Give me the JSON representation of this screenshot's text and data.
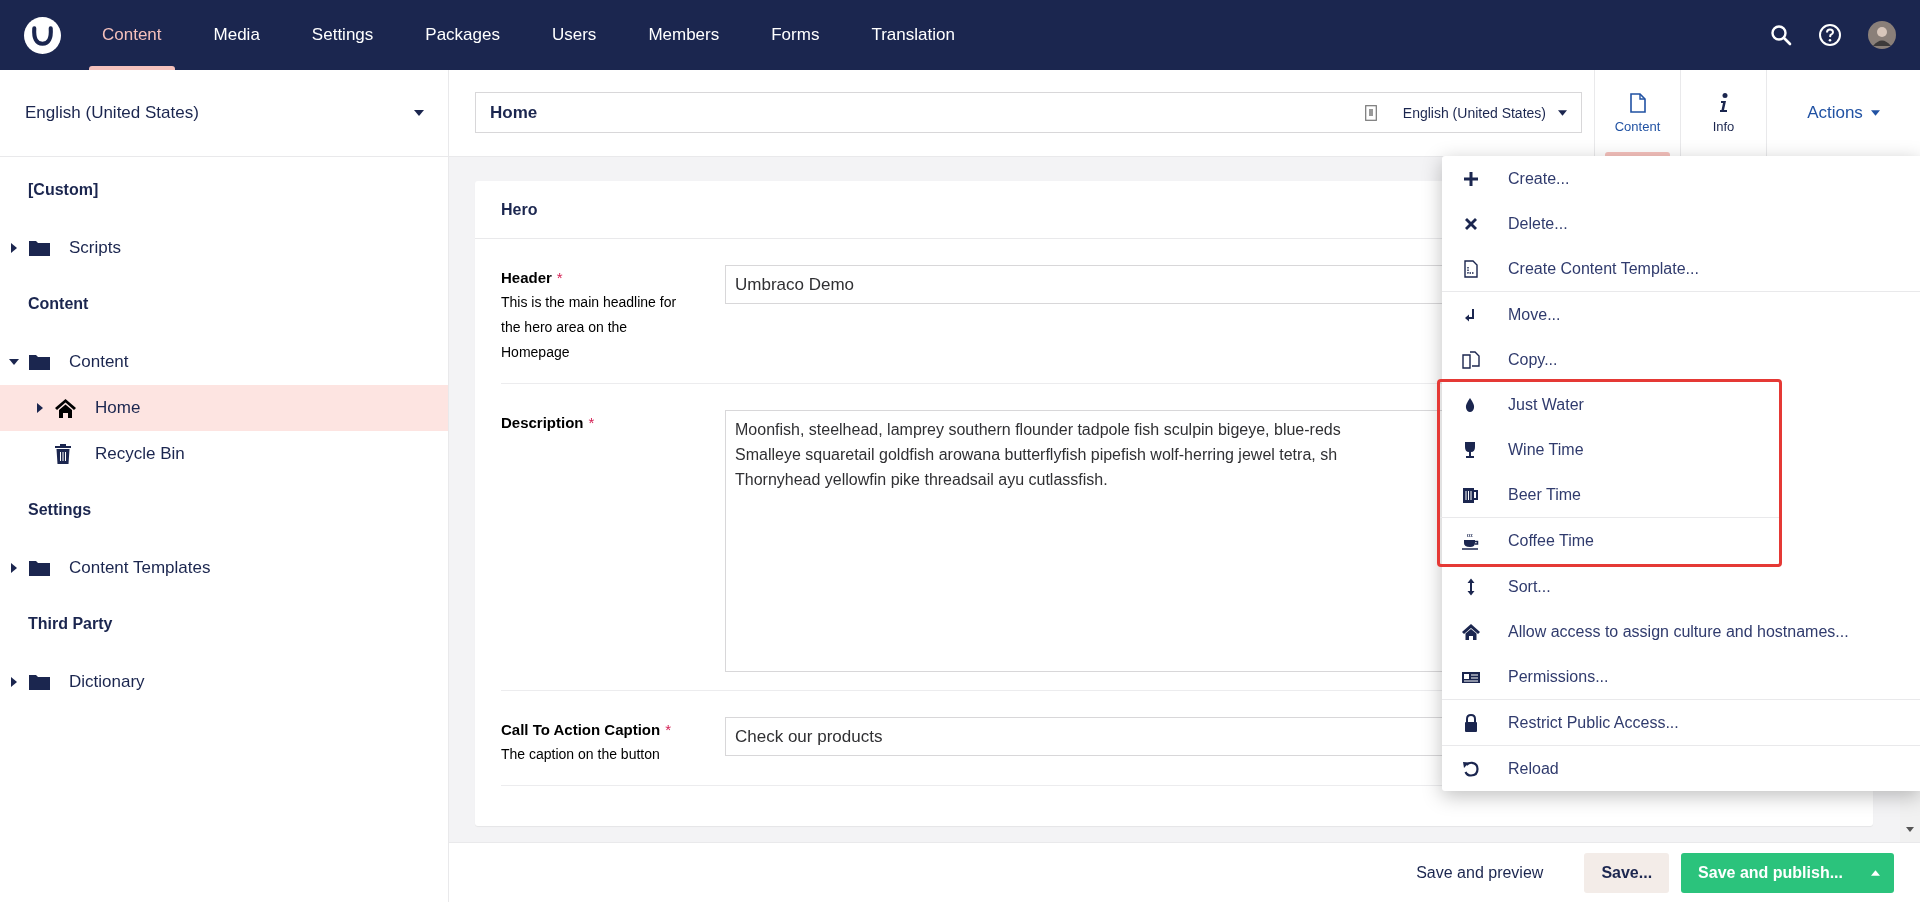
{
  "top_nav": {
    "sections": [
      {
        "label": "Content",
        "selected": true
      },
      {
        "label": "Media",
        "selected": false
      },
      {
        "label": "Settings",
        "selected": false
      },
      {
        "label": "Packages",
        "selected": false
      },
      {
        "label": "Users",
        "selected": false
      },
      {
        "label": "Members",
        "selected": false
      },
      {
        "label": "Forms",
        "selected": false
      },
      {
        "label": "Translation",
        "selected": false
      }
    ]
  },
  "sidebar": {
    "language": "English (United States)",
    "tree": [
      {
        "title": "[Custom]",
        "items": [
          {
            "label": "Scripts",
            "kind": "folder",
            "expandable": true,
            "expanded": false,
            "selected": false
          }
        ]
      },
      {
        "title": "Content",
        "items": [
          {
            "label": "Content",
            "kind": "folder",
            "expandable": true,
            "expanded": true,
            "selected": false,
            "children": [
              {
                "label": "Home",
                "kind": "page",
                "expandable": true,
                "expanded": false,
                "selected": true
              },
              {
                "label": "Recycle Bin",
                "kind": "bin",
                "expandable": false,
                "expanded": false,
                "selected": false
              }
            ]
          }
        ]
      },
      {
        "title": "Settings",
        "items": [
          {
            "label": "Content Templates",
            "kind": "folder",
            "expandable": true,
            "expanded": false,
            "selected": false
          }
        ]
      },
      {
        "title": "Third Party",
        "items": [
          {
            "label": "Dictionary",
            "kind": "folder",
            "expandable": true,
            "expanded": false,
            "selected": false
          }
        ]
      }
    ]
  },
  "editor": {
    "name": "Home",
    "language": "English (United States)",
    "apps": [
      {
        "label": "Content",
        "selected": true
      },
      {
        "label": "Info",
        "selected": false
      }
    ],
    "actions_label": "Actions"
  },
  "card": {
    "title": "Hero",
    "fields": [
      {
        "label": "Header",
        "required_mark": "*",
        "hint": "This is the main headline for the hero area on the Homepage",
        "kind": "input",
        "value": "Umbraco Demo"
      },
      {
        "label": "Description",
        "required_mark": "*",
        "kind": "textarea",
        "lines": [
          "Moonfish, steelhead, lamprey southern flounder tadpole fish sculpin bigeye, blue-reds",
          "Smalleye squaretail goldfish arowana butterflyfish pipefish wolf-herring jewel tetra, sh",
          "Thornyhead yellowfin pike threadsail ayu cutlassfish."
        ]
      },
      {
        "label": "Call To Action Caption",
        "required_mark": "*",
        "hint": "The caption on the button",
        "kind": "input",
        "value": "Check our products"
      }
    ]
  },
  "actions_menu": {
    "items": [
      {
        "label": "Create...",
        "divider_after": false,
        "highlighted": false
      },
      {
        "label": "Delete...",
        "divider_after": false,
        "highlighted": false
      },
      {
        "label": "Create Content Template...",
        "divider_after": true,
        "highlighted": false
      },
      {
        "label": "Move...",
        "divider_after": false,
        "highlighted": false
      },
      {
        "label": "Copy...",
        "divider_after": false,
        "highlighted": false
      },
      {
        "label": "Just Water",
        "divider_after": false,
        "highlighted": true
      },
      {
        "label": "Wine Time",
        "divider_after": false,
        "highlighted": true
      },
      {
        "label": "Beer Time",
        "divider_after": true,
        "highlighted": true
      },
      {
        "label": "Coffee Time",
        "divider_after": true,
        "highlighted": true
      },
      {
        "label": "Sort...",
        "divider_after": false,
        "highlighted": false
      },
      {
        "label": "Allow access to assign culture and hostnames...",
        "divider_after": false,
        "highlighted": false
      },
      {
        "label": "Permissions...",
        "divider_after": true,
        "highlighted": false
      },
      {
        "label": "Restrict Public Access...",
        "divider_after": true,
        "highlighted": false
      },
      {
        "label": "Reload",
        "divider_after": false,
        "highlighted": false
      }
    ]
  },
  "footer": {
    "buttons": [
      {
        "label": "Save and preview",
        "kind": "link"
      },
      {
        "label": "Save...",
        "kind": "secondary"
      },
      {
        "label": "Save and publish...",
        "kind": "primary"
      }
    ]
  }
}
